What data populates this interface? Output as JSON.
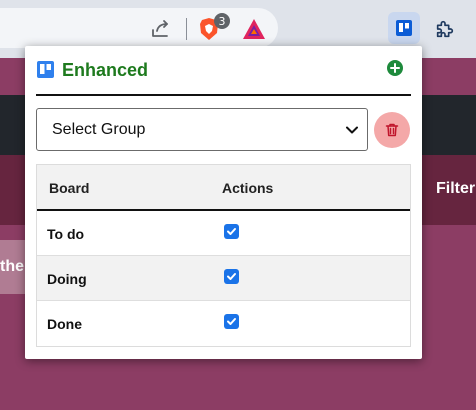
{
  "browser": {
    "brave_badge_count": "3"
  },
  "page": {
    "filter_label": "Filter",
    "side_chip_text": "the"
  },
  "popup": {
    "title": "Enhanced",
    "group_select": {
      "selected": "Select Group"
    },
    "table": {
      "headers": [
        "Board",
        "Actions"
      ],
      "rows": [
        {
          "board": "To do",
          "checked": true
        },
        {
          "board": "Doing",
          "checked": true
        },
        {
          "board": "Done",
          "checked": true
        }
      ]
    }
  },
  "colors": {
    "title_green": "#1e7a1e",
    "checkbox_blue": "#1a73e8",
    "delete_pink": "#f4a8a8",
    "page_magenta": "#8c3d64"
  }
}
